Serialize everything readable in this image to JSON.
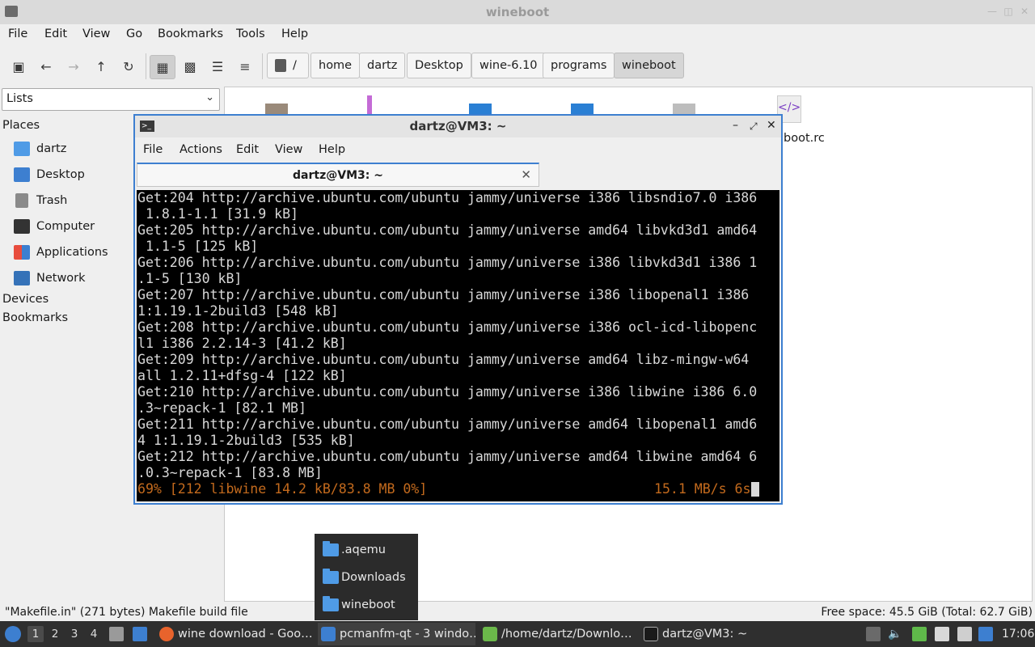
{
  "file_manager": {
    "title": "wineboot",
    "menu": [
      "File",
      "Edit",
      "View",
      "Go",
      "Bookmarks",
      "Tools",
      "Help"
    ],
    "breadcrumbs": [
      "/",
      "home",
      "dartz",
      "Desktop",
      "wine-6.10",
      "programs",
      "wineboot"
    ],
    "side_pane_mode": "Lists",
    "sidebar": {
      "places_label": "Places",
      "places": [
        {
          "label": "dartz",
          "icon": "home-folder-icon"
        },
        {
          "label": "Desktop",
          "icon": "desktop-icon"
        },
        {
          "label": "Trash",
          "icon": "trash-icon"
        },
        {
          "label": "Computer",
          "icon": "computer-icon"
        },
        {
          "label": "Applications",
          "icon": "applications-icon"
        },
        {
          "label": "Network",
          "icon": "network-icon"
        }
      ],
      "devices_label": "Devices",
      "bookmarks_label": "Bookmarks"
    },
    "visible_file_fragment": "boot.rc",
    "status_left": "\"Makefile.in\" (271 bytes) Makefile build file",
    "status_right": "Free space: 45.5 GiB (Total: 62.7 GiB)"
  },
  "terminal": {
    "title": "dartz@VM3: ~",
    "menu": [
      "File",
      "Actions",
      "Edit",
      "View",
      "Help"
    ],
    "tab_label": "dartz@VM3: ~",
    "lines": [
      "Get:204 http://archive.ubuntu.com/ubuntu jammy/universe i386 libsndio7.0 i386",
      " 1.8.1-1.1 [31.9 kB]",
      "Get:205 http://archive.ubuntu.com/ubuntu jammy/universe amd64 libvkd3d1 amd64",
      " 1.1-5 [125 kB]",
      "Get:206 http://archive.ubuntu.com/ubuntu jammy/universe i386 libvkd3d1 i386 1",
      ".1-5 [130 kB]",
      "Get:207 http://archive.ubuntu.com/ubuntu jammy/universe i386 libopenal1 i386",
      "1:1.19.1-2build3 [548 kB]",
      "Get:208 http://archive.ubuntu.com/ubuntu jammy/universe i386 ocl-icd-libopenc",
      "l1 i386 2.2.14-3 [41.2 kB]",
      "Get:209 http://archive.ubuntu.com/ubuntu jammy/universe amd64 libz-mingw-w64",
      "all 1.2.11+dfsg-4 [122 kB]",
      "Get:210 http://archive.ubuntu.com/ubuntu jammy/universe i386 libwine i386 6.0",
      ".3~repack-1 [82.1 MB]",
      "Get:211 http://archive.ubuntu.com/ubuntu jammy/universe amd64 libopenal1 amd6",
      "4 1:1.19.1-2build3 [535 kB]",
      "Get:212 http://archive.ubuntu.com/ubuntu jammy/universe amd64 libwine amd64 6",
      ".0.3~repack-1 [83.8 MB]"
    ],
    "progress_left": "69% [212 libwine 14.2 kB/83.8 MB 0%]",
    "progress_right": "15.1 MB/s 6s",
    "progress_color": "#c36a1d"
  },
  "folder_popup": {
    "items": [
      ".aqemu",
      "Downloads",
      "wineboot"
    ]
  },
  "taskbar": {
    "workspaces": [
      "1",
      "2",
      "3",
      "4"
    ],
    "tasks": [
      {
        "label": "wine download - Goo…",
        "icon": "firefox-icon"
      },
      {
        "label": "pcmanfm-qt - 3 windo…",
        "icon": "folder-icon"
      },
      {
        "label": "/home/dartz/Downlo…",
        "icon": "archive-icon"
      },
      {
        "label": "dartz@VM3: ~",
        "icon": "terminal-icon"
      }
    ],
    "clock": "17:06"
  }
}
